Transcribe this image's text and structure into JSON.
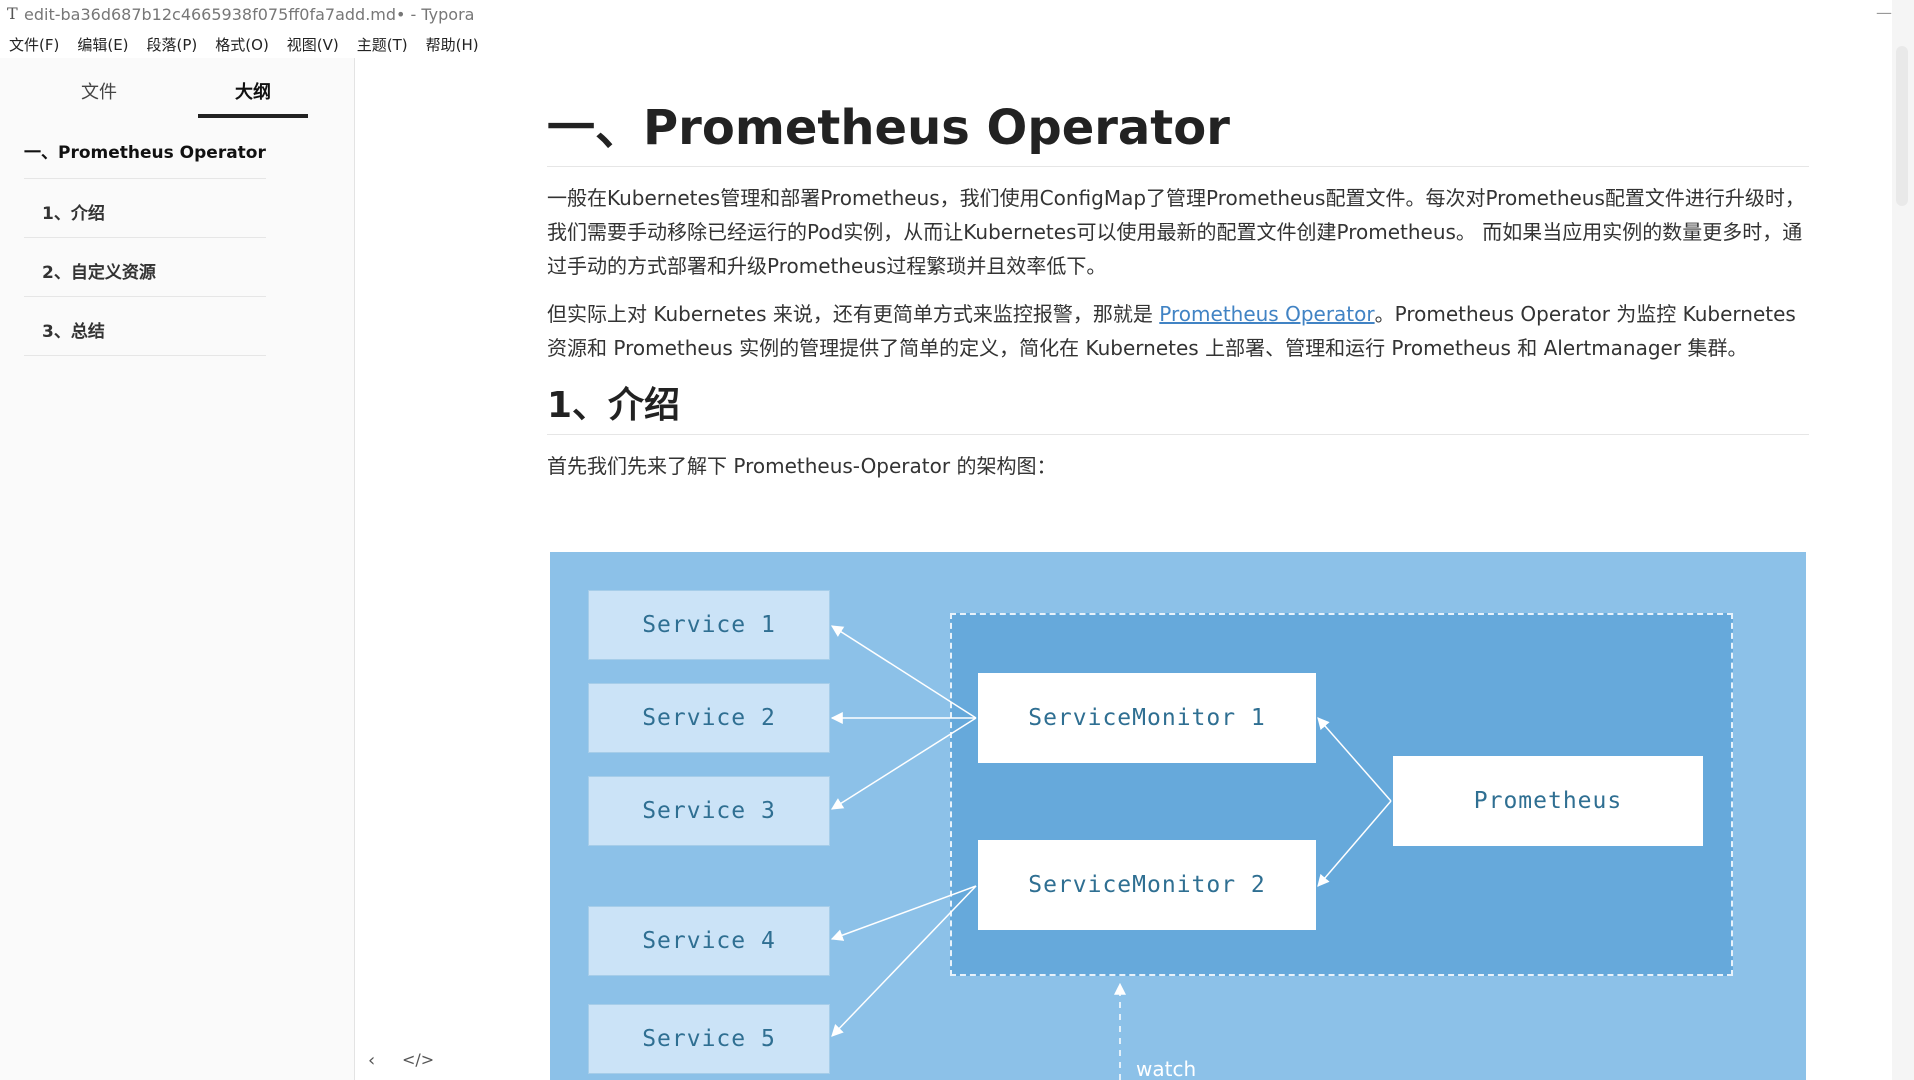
{
  "window": {
    "app_icon": "T",
    "title": "edit-ba36d687b12c4665938f075ff0fa7add.md• - Typora",
    "minimize": "—"
  },
  "menubar": [
    "文件(F)",
    "编辑(E)",
    "段落(P)",
    "格式(O)",
    "视图(V)",
    "主题(T)",
    "帮助(H)"
  ],
  "sidebar": {
    "tab_files": "文件",
    "tab_outline": "大纲",
    "outline": [
      {
        "label": "一、Prometheus Operator"
      },
      {
        "label": "1、介绍"
      },
      {
        "label": "2、自定义资源"
      },
      {
        "label": "3、总结"
      }
    ],
    "prev_icon": "‹",
    "source_icon": "</>"
  },
  "content": {
    "h1": "一、Prometheus Operator",
    "para1": "一般在Kubernetes管理和部署Prometheus，我们使用ConfigMap了管理Prometheus配置文件。每次对Prometheus配置文件进行升级时，我们需要手动移除已经运行的Pod实例，从而让Kubernetes可以使用最新的配置文件创建Prometheus。 而如果当应用实例的数量更多时，通过手动的方式部署和升级Prometheus过程繁琐并且效率低下。",
    "para2_before": "但实际上对 Kubernetes 来说，还有更简单方式来监控报警，那就是 ",
    "para2_link": "Prometheus Operator",
    "para2_after": "。Prometheus Operator 为监控 Kubernetes 资源和 Prometheus 实例的管理提供了简单的定义，简化在 Kubernetes 上部署、管理和运行 Prometheus 和 Alertmanager 集群。",
    "h2": "1、介绍",
    "para3": "首先我们先来了解下 Prometheus-Operator 的架构图："
  },
  "diagram": {
    "services": [
      "Service 1",
      "Service 2",
      "Service 3",
      "Service 4",
      "Service 5"
    ],
    "monitor1": "ServiceMonitor 1",
    "monitor2": "ServiceMonitor 2",
    "prometheus": "Prometheus",
    "watch": "watch"
  }
}
